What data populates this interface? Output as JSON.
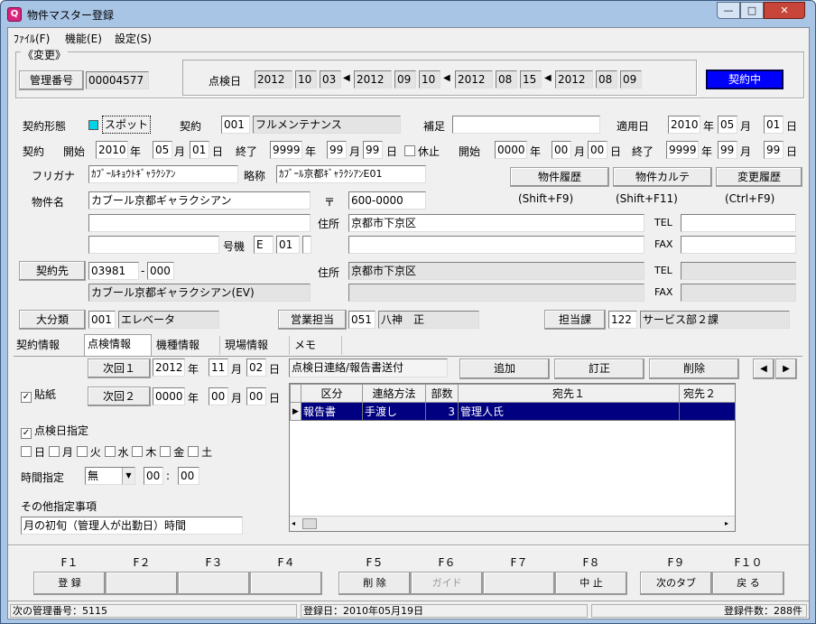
{
  "window": {
    "title": "物件マスター登録",
    "app_icon": "Q",
    "minimize": "—",
    "maximize": "□",
    "close": "✕"
  },
  "menu": [
    "ﾌｧｲﾙ(F)",
    "機能(E)",
    "設定(S)"
  ],
  "header": {
    "mode": "《変更》",
    "kanri_label": "管理番号",
    "kanri_value": "00004577",
    "tenken_label": "点検日",
    "dates": [
      [
        "2012",
        "10",
        "03"
      ],
      [
        "2012",
        "09",
        "10"
      ],
      [
        "2012",
        "08",
        "15"
      ],
      [
        "2012",
        "08",
        "09"
      ]
    ],
    "arrow": "◀",
    "status": "契約中",
    "status_color": "#0000ff"
  },
  "contract": {
    "keitai_label": "契約形態",
    "keitai_value": "スポット",
    "keiyaku_label": "契約",
    "keiyaku_code": "001",
    "keiyaku_name": "フルメンテナンス",
    "hosoku_label": "補足",
    "hosoku_value": "",
    "tekiyo_label": "適用日",
    "tekiyo": [
      "2010",
      "05",
      "01"
    ],
    "period_label": "契約",
    "start_label": "開始",
    "start": [
      "2010",
      "05",
      "01"
    ],
    "end_label": "終了",
    "end": [
      "9999",
      "99",
      "99"
    ],
    "kyushi_label": "休止",
    "k_start": [
      "0000",
      "00",
      "00"
    ],
    "k_end": [
      "9999",
      "99",
      "99"
    ]
  },
  "units": {
    "y": "年",
    "m": "月",
    "d": "日",
    "sep": "-"
  },
  "property": {
    "furigana_label": "フリガナ",
    "furigana": "ｶﾌﾞｰﾙｷｮｳﾄｷﾞｬﾗｸｼｱﾝ",
    "ryakusho_label": "略称",
    "ryakusho": "ｶﾌﾞｰﾙ京都ｷﾞｬﾗｸｼｱﾝE01",
    "name_label": "物件名",
    "name": "カブール京都ギャラクシアン",
    "name2": "",
    "name3": "",
    "goki_label": "号機",
    "goki1": "E",
    "goki2": "01",
    "zip_label": "〒",
    "zip": "600-0000",
    "addr_label": "住所",
    "addr": "京都市下京区",
    "addr2": "",
    "tel_label": "TEL",
    "tel": "",
    "fax_label": "FAX",
    "fax": ""
  },
  "buttons": {
    "rireki": "物件履歴",
    "rireki_key": "(Shift+F9)",
    "karute": "物件カルテ",
    "karute_key": "(Shift+F11)",
    "henko": "変更履歴",
    "henko_key": "(Ctrl+F9)"
  },
  "client": {
    "label": "契約先",
    "code1": "03981",
    "code2": "000",
    "name": "カブール京都ギャラクシアン(EV)",
    "addr_label": "住所",
    "addr": "京都市下京区",
    "addr2": "",
    "tel_label": "TEL",
    "fax_label": "FAX"
  },
  "category": {
    "label": "大分類",
    "code": "001",
    "name": "エレベータ",
    "eigyo_label": "営業担当",
    "eigyo_code": "051",
    "eigyo_name": "八神　正",
    "tanto_label": "担当課",
    "tanto_code": "122",
    "tanto_name": "サービス部２課"
  },
  "tabs": [
    "契約情報",
    "点検情報",
    "機種情報",
    "現場情報",
    "メモ"
  ],
  "inspection": {
    "next1_label": "次回１",
    "next1": [
      "2012",
      "11",
      "02"
    ],
    "next2_label": "次回２",
    "next2": [
      "0000",
      "00",
      "00"
    ],
    "harigami": "貼紙",
    "shitei": "点検日指定",
    "days": [
      "日",
      "月",
      "火",
      "水",
      "木",
      "金",
      "土"
    ],
    "time_label": "時間指定",
    "time_value": "無",
    "hour": "00",
    "min": "00",
    "other_label": "その他指定事項",
    "other_value": "月の初旬（管理人が出勤日）時間"
  },
  "report": {
    "title": "点検日連絡/報告書送付",
    "add": "追加",
    "edit": "訂正",
    "del": "削除",
    "prev": "◀",
    "next": "▶",
    "columns": [
      "区分",
      "連絡方法",
      "部数",
      "宛先１",
      "宛先２"
    ],
    "rows": [
      [
        "報告書",
        "手渡し",
        "3",
        "管理人氏",
        ""
      ]
    ],
    "row_marker": "▶"
  },
  "fkeys": [
    {
      "k": "F１",
      "l": "登 録"
    },
    {
      "k": "F２",
      "l": ""
    },
    {
      "k": "F３",
      "l": ""
    },
    {
      "k": "F４",
      "l": ""
    },
    {
      "k": "F５",
      "l": "削 除"
    },
    {
      "k": "F６",
      "l": "ガイド"
    },
    {
      "k": "F７",
      "l": ""
    },
    {
      "k": "F８",
      "l": "中 止"
    },
    {
      "k": "F９",
      "l": "次のタブ"
    },
    {
      "k": "F１０",
      "l": "戻 る"
    }
  ],
  "statusbar": {
    "next": "次の管理番号：5115",
    "reg": "登録日：2010年05月19日",
    "count": "登録件数：288件"
  }
}
